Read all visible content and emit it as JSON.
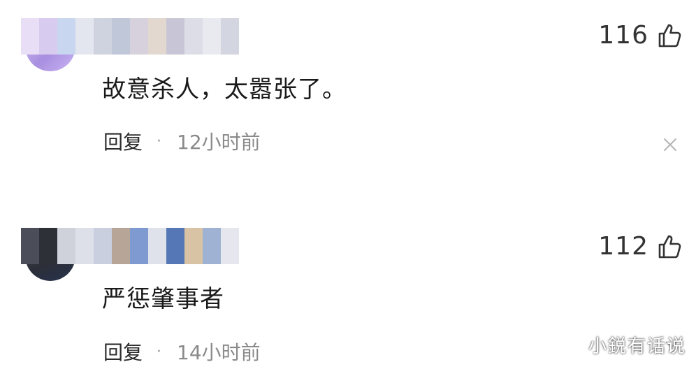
{
  "comments": [
    {
      "likes": "116",
      "text": "故意杀人，太嚣张了。",
      "reply_label": "回复",
      "separator": "·",
      "time": "12小时前",
      "avatar_colors": [
        "#d9c7f0",
        "#a88fe0"
      ],
      "blur_colors": [
        "#e8dff6",
        "#d8cbf0",
        "#c9d6ef",
        "#e4e6ef",
        "#cfd3df",
        "#bfc7d8",
        "#d6d1dc",
        "#e2d8d0",
        "#c8c6d6",
        "#dcdde6",
        "#e9eaf0",
        "#d3d5e0"
      ]
    },
    {
      "likes": "112",
      "text": "严惩肇事者",
      "reply_label": "回复",
      "separator": "·",
      "time": "14小时前",
      "avatar_colors": [
        "#4a4d57",
        "#26324d"
      ],
      "blur_colors": [
        "#4b4d58",
        "#2e3038",
        "#cfd2da",
        "#dde0e8",
        "#c9cfde",
        "#b7a597",
        "#7f9ad0",
        "#dfe2ea",
        "#5677b5",
        "#d9c3a5",
        "#9fb2d3",
        "#e6e7ee"
      ]
    }
  ],
  "watermark": "小鋭有话说",
  "icons": {
    "like": "thumbs-up-icon",
    "dismiss": "close-icon"
  }
}
